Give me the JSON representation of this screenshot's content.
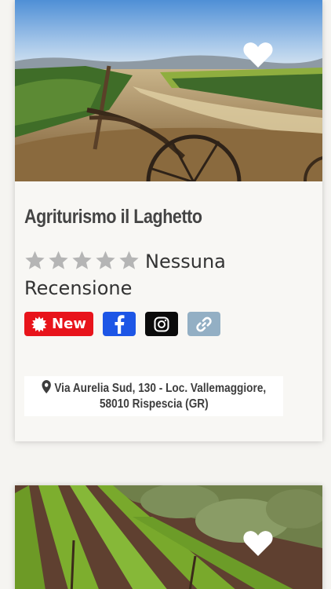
{
  "listings": [
    {
      "title": "Agriturismo il Laghetto",
      "rating_stars": 0,
      "max_stars": 5,
      "review_text": "Nessuna Recensione",
      "new_badge": "New",
      "socials": [
        "facebook-icon",
        "instagram-icon",
        "link-icon"
      ],
      "address_line1": "Via Aurelia Sud, 130 - Loc. Vallemaggiore,",
      "address_line2": "58010 Rispescia (GR)",
      "favorite_icon": "heart-icon",
      "image": "vineyard-with-old-wheel-photo"
    },
    {
      "favorite_icon": "heart-icon",
      "image": "vineyard-rows-photo"
    }
  ],
  "colors": {
    "new_badge": "#e8141b",
    "facebook": "#1d56e6",
    "instagram": "#0b0b0b",
    "link": "#93afc4",
    "star_empty": "#b5b5b5",
    "title": "#444444"
  }
}
